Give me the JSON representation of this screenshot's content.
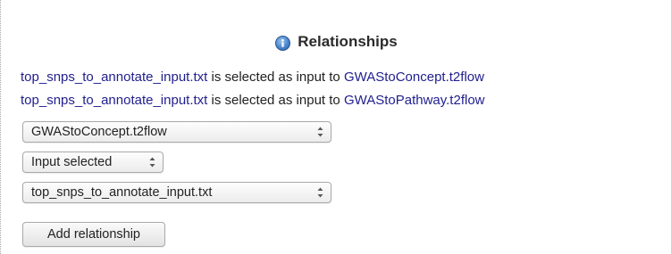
{
  "title": "Relationships",
  "relationships": [
    {
      "file": "top_snps_to_annotate_input.txt",
      "connector": " is selected as input to ",
      "target": "GWAStoConcept.t2flow"
    },
    {
      "file": "top_snps_to_annotate_input.txt",
      "connector": " is selected as input to ",
      "target": "GWAStoPathway.t2flow"
    }
  ],
  "form": {
    "workflow_select": "GWAStoConcept.t2flow",
    "relation_select": "Input selected",
    "file_select": "top_snps_to_annotate_input.txt",
    "add_button": "Add relationship"
  },
  "colors": {
    "link": "#22208f",
    "text": "#222222",
    "info_icon": "#4a86cc"
  }
}
